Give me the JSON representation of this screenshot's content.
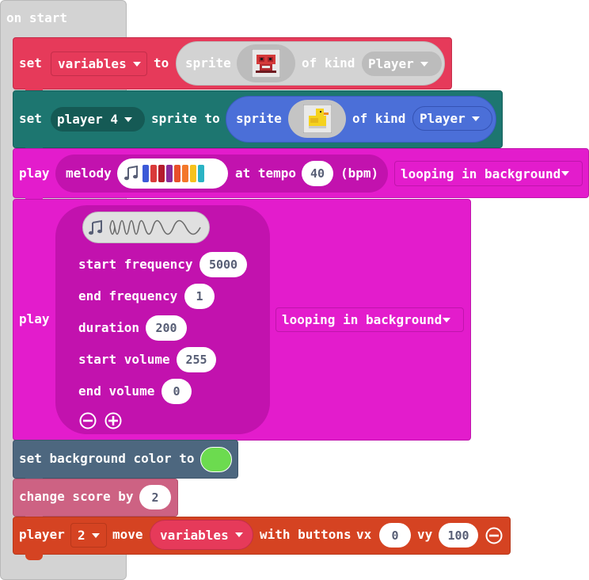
{
  "colors": {
    "hat": "#d3d3d3",
    "sprite_block": "#e63a5a",
    "sprite_pill": "#cfcfcf",
    "dark_teal": "#1d7670",
    "sprite_blue": "#4b6fd8",
    "music": "#e31ccc",
    "music_inner": "#c212ae",
    "scene": "#4d677f",
    "info": "#cd6283",
    "controller": "#d54322",
    "bg_color_swatch": "#6cdb4f"
  },
  "hat": {
    "label": "on start"
  },
  "block1": {
    "set": "set",
    "variable": "variables",
    "to": "to",
    "sprite": "sprite",
    "sprite_icon": "red-crab-sprite-icon",
    "of_kind": "of kind",
    "kind": "Player"
  },
  "block2": {
    "set": "set",
    "variable": "player 4",
    "sprite_to": "sprite to",
    "sprite": "sprite",
    "sprite_icon": "yellow-duck-sprite-icon",
    "of_kind": "of kind",
    "kind": "Player"
  },
  "block3": {
    "play": "play",
    "melody": "melody",
    "melody_icon": "music-note-icon",
    "melody_colors": [
      "#3c5ad8",
      "#d93a3a",
      "#b41c2c",
      "#8a2b9a",
      "#e84f2a",
      "#f3772a",
      "#f7c21c",
      "#2bb3c4"
    ],
    "at_tempo": "at tempo",
    "tempo": "40",
    "bpm": "(bpm)",
    "mode": "looping in background"
  },
  "block4": {
    "play": "play",
    "wave_icon": "sound-wave-icon",
    "rows": [
      {
        "label": "start frequency",
        "value": "5000"
      },
      {
        "label": "end frequency",
        "value": "1"
      },
      {
        "label": "duration",
        "value": "200"
      },
      {
        "label": "start volume",
        "value": "255"
      },
      {
        "label": "end volume",
        "value": "0"
      }
    ],
    "mode": "looping in background"
  },
  "block5": {
    "label": "set background color to"
  },
  "block6": {
    "label": "change score by",
    "value": "2"
  },
  "block7": {
    "player": "player",
    "player_num": "2",
    "move": "move",
    "variable": "variables",
    "with_buttons": "with buttons",
    "vx": "vx",
    "vx_value": "0",
    "vy": "vy",
    "vy_value": "100"
  }
}
